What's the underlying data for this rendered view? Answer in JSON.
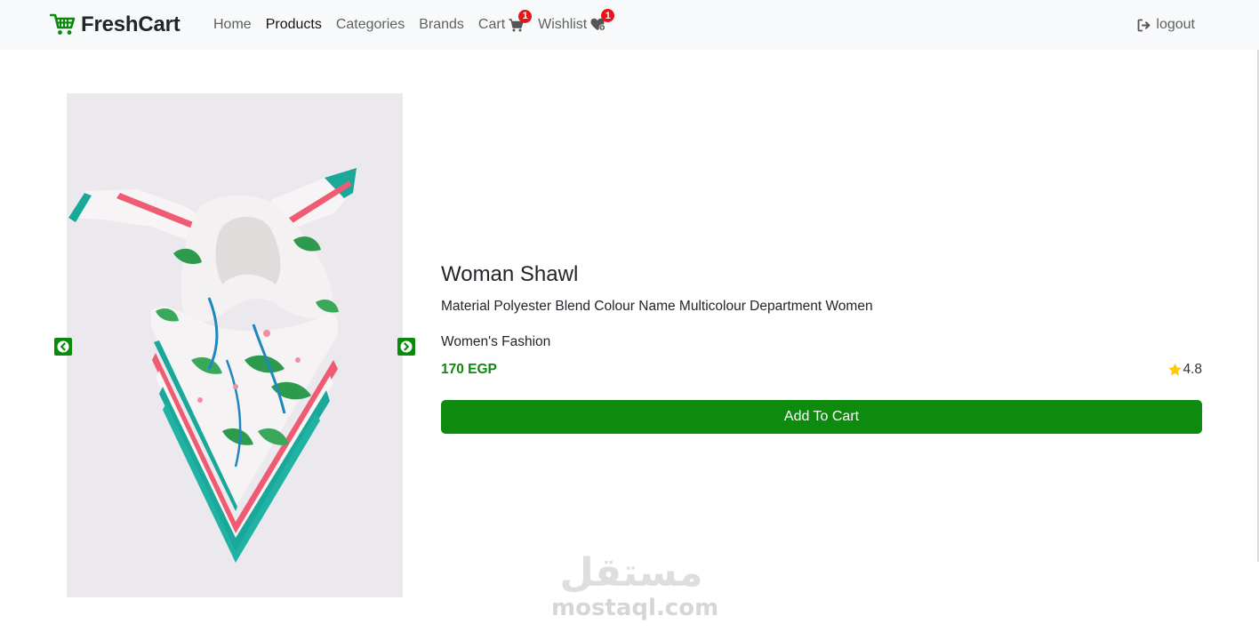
{
  "nav": {
    "brand": "FreshCart",
    "links": [
      "Home",
      "Products",
      "Categories",
      "Brands",
      "Cart",
      "Wishlist"
    ],
    "active": "Products",
    "cart_count": "1",
    "wishlist_count": "1",
    "logout": "logout"
  },
  "product": {
    "title": "Woman Shawl",
    "description": "Material Polyester Blend Colour Name Multicolour Department Women",
    "category": "Women's Fashion",
    "price": "170 EGP",
    "rating": "4.8",
    "add_to_cart": "Add To Cart"
  },
  "colors": {
    "brand_green": "#0a8a0a",
    "badge_red": "#e4161b",
    "star": "#ffc908"
  },
  "watermark": {
    "arabic": "مستقل",
    "latin": "mostaql.com"
  }
}
